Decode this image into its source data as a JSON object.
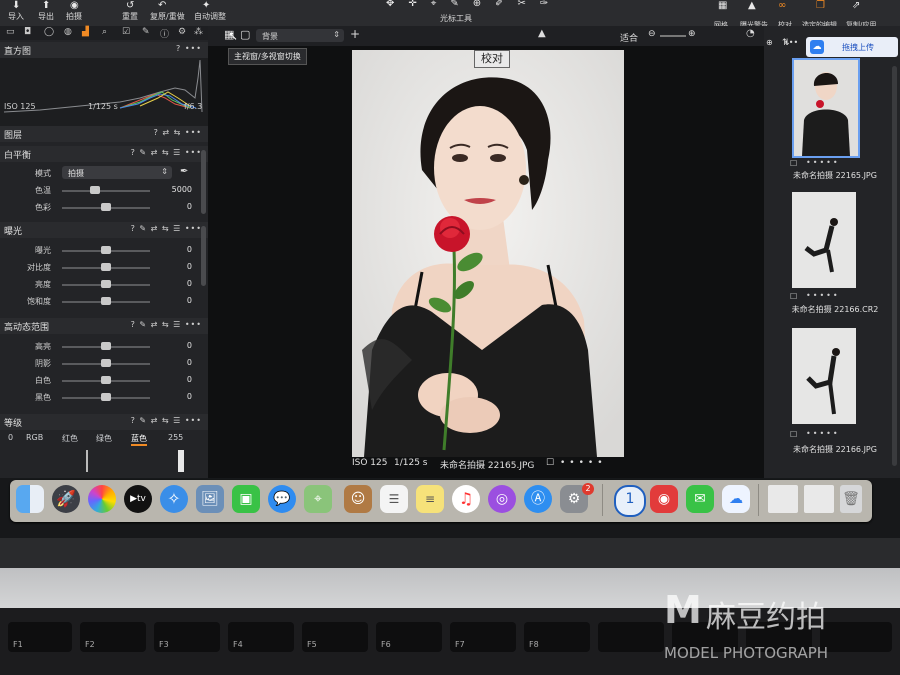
{
  "toolbar": {
    "import": "导入",
    "export": "导出",
    "capture": "拍摄",
    "reset": "重置",
    "undo_redo": "复原/重做",
    "auto_adjust": "自动调整",
    "cursor_tools": "光标工具",
    "grid": "网格",
    "exposure_warning": "曝光警告",
    "proof": "校对",
    "selected_edit": "选定的编辑",
    "copy_apply": "复制/应用"
  },
  "histogram": {
    "title": "直方图",
    "iso": "ISO 125",
    "shutter": "1/125 s",
    "aperture": "f/6.3"
  },
  "layers": {
    "title": "图层"
  },
  "white_balance": {
    "title": "白平衡",
    "mode_label": "模式",
    "mode_value": "拍摄",
    "temp_label": "色温",
    "temp_value": "5000",
    "temp_level": 0.38,
    "tint_label": "色彩",
    "tint_value": "0",
    "tint_level": 0.5
  },
  "exposure": {
    "title": "曝光",
    "rows": [
      {
        "label": "曝光",
        "value": "0",
        "level": 0.5
      },
      {
        "label": "对比度",
        "value": "0",
        "level": 0.5
      },
      {
        "label": "亮度",
        "value": "0",
        "level": 0.5
      },
      {
        "label": "饱和度",
        "value": "0",
        "level": 0.5
      }
    ]
  },
  "hdr": {
    "title": "高动态范围",
    "rows": [
      {
        "label": "高亮",
        "value": "0",
        "level": 0.5
      },
      {
        "label": "阴影",
        "value": "0",
        "level": 0.5
      },
      {
        "label": "白色",
        "value": "0",
        "level": 0.5
      },
      {
        "label": "黑色",
        "value": "0",
        "level": 0.5
      }
    ]
  },
  "levels": {
    "title": "等级",
    "low": "0",
    "tabs": [
      "RGB",
      "红色",
      "绿色",
      "蓝色"
    ],
    "active_tab": "蓝色",
    "high": "255"
  },
  "viewer": {
    "tooltip": "主视窗/多视窗切换",
    "background_select": "背景",
    "fit": "适合",
    "proof_badge": "校对",
    "caption_iso": "ISO 125",
    "caption_shutter": "1/125 s",
    "caption_file": "未命名拍摄 22165.JPG"
  },
  "browser": {
    "upload_button": "拖拽上传",
    "items": [
      {
        "name": "未命名拍摄 22165.JPG",
        "selected": true
      },
      {
        "name": "未命名拍摄 22166.CR2",
        "selected": false
      },
      {
        "name": "未命名拍摄 22166.JPG",
        "selected": false
      }
    ]
  },
  "dock": {
    "badge": "2"
  },
  "keyboard": {
    "keys": [
      "F1",
      "F2",
      "F3",
      "F4",
      "F5",
      "F6",
      "F7",
      "F8"
    ]
  },
  "watermark": {
    "brand": "麻豆约拍",
    "sub": "MODEL PHOTOGRAPH"
  },
  "colors": {
    "accent_orange": "#f08a24",
    "panel_bg": "#232427",
    "upload_blue": "#2f7ff0"
  }
}
